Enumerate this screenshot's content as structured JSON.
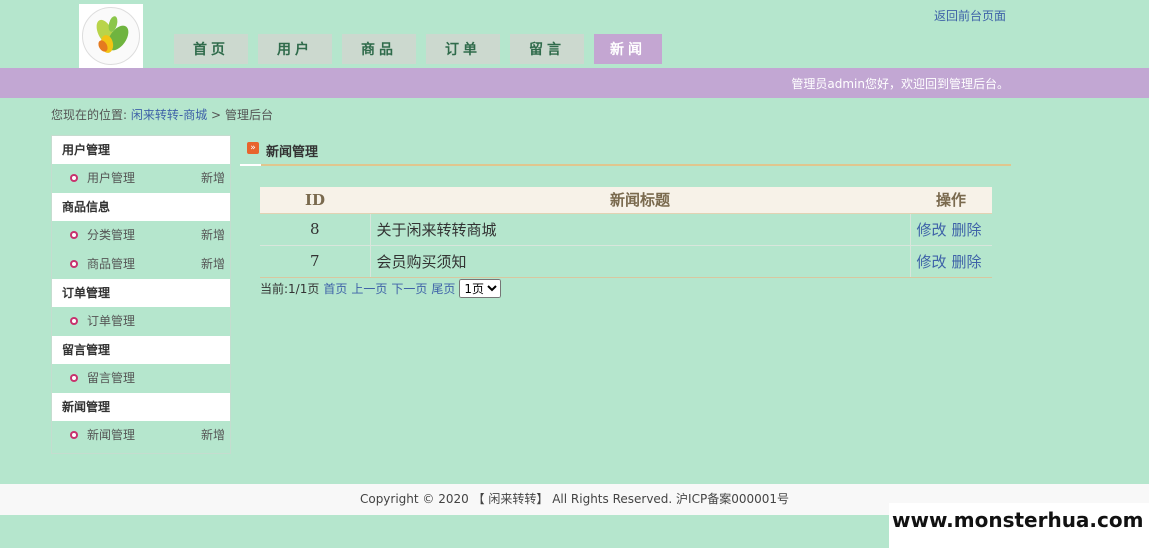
{
  "header": {
    "nav": [
      {
        "label": "首页"
      },
      {
        "label": "用户"
      },
      {
        "label": "商品"
      },
      {
        "label": "订单"
      },
      {
        "label": "留言"
      },
      {
        "label": "新闻"
      }
    ],
    "active_nav": "新闻",
    "back_link": "返回前台页面",
    "welcome": "管理员admin您好，欢迎回到管理后台。"
  },
  "breadcrumb": {
    "prefix": "您现在的位置:",
    "home": "闲来转转-商城",
    "separator": ">",
    "current": "管理后台"
  },
  "sidebar": {
    "groups": [
      {
        "title": "用户管理",
        "items": [
          {
            "label": "用户管理",
            "add": "新增"
          }
        ]
      },
      {
        "title": "商品信息",
        "items": [
          {
            "label": "分类管理",
            "add": "新增"
          },
          {
            "label": "商品管理",
            "add": "新增"
          }
        ]
      },
      {
        "title": "订单管理",
        "items": [
          {
            "label": "订单管理",
            "add": ""
          }
        ]
      },
      {
        "title": "留言管理",
        "items": [
          {
            "label": "留言管理",
            "add": ""
          }
        ]
      },
      {
        "title": "新闻管理",
        "items": [
          {
            "label": "新闻管理",
            "add": "新增"
          }
        ]
      }
    ]
  },
  "main": {
    "title": "新闻管理",
    "table": {
      "headers": [
        "ID",
        "新闻标题",
        "操作"
      ],
      "rows": [
        {
          "id": "8",
          "title": "关于闲来转转商城",
          "edit": "修改",
          "delete": "删除"
        },
        {
          "id": "7",
          "title": "会员购买须知",
          "edit": "修改",
          "delete": "删除"
        }
      ]
    },
    "pager": {
      "info": "当前:1/1页",
      "first": "首页",
      "prev": "上一页",
      "next": "下一页",
      "last": "尾页",
      "select_value": "1页"
    }
  },
  "footer": {
    "text": "Copyright © 2020 【 闲来转转】 All Rights Reserved. 沪ICP备案000001号"
  },
  "watermark": "www.monsterhua.com",
  "colors": {
    "background": "#b5e6cd",
    "accent_purple": "#c2a7d3",
    "link": "#3e62a8"
  }
}
